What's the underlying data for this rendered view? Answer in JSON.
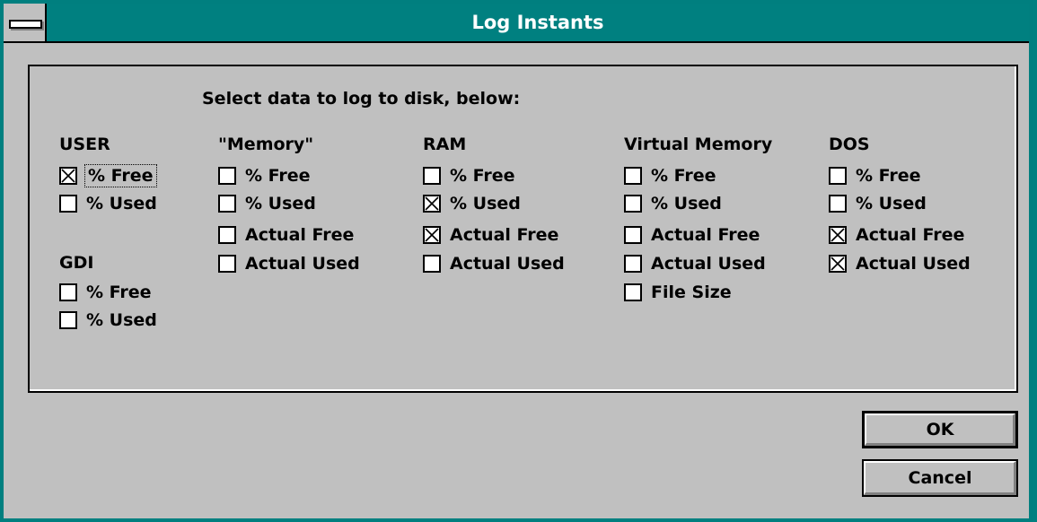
{
  "window": {
    "title": "Log Instants"
  },
  "instruction": "Select data to log to disk, below:",
  "groups": {
    "user": {
      "heading": "USER",
      "items": [
        {
          "label": "% Free",
          "checked": true
        },
        {
          "label": "% Used",
          "checked": false
        }
      ]
    },
    "gdi": {
      "heading": "GDI",
      "items": [
        {
          "label": "% Free",
          "checked": false
        },
        {
          "label": "% Used",
          "checked": false
        }
      ]
    },
    "memory": {
      "heading": "\"Memory\"",
      "items": [
        {
          "label": "% Free",
          "checked": false
        },
        {
          "label": "% Used",
          "checked": false
        },
        {
          "label": "Actual Free",
          "checked": false
        },
        {
          "label": "Actual Used",
          "checked": false
        }
      ]
    },
    "ram": {
      "heading": "RAM",
      "items": [
        {
          "label": "% Free",
          "checked": false
        },
        {
          "label": "% Used",
          "checked": true
        },
        {
          "label": "Actual Free",
          "checked": true
        },
        {
          "label": "Actual Used",
          "checked": false
        }
      ]
    },
    "virtual": {
      "heading": "Virtual Memory",
      "items": [
        {
          "label": "% Free",
          "checked": false
        },
        {
          "label": "% Used",
          "checked": false
        },
        {
          "label": "Actual Free",
          "checked": false
        },
        {
          "label": "Actual Used",
          "checked": false
        },
        {
          "label": "File Size",
          "checked": false
        }
      ]
    },
    "dos": {
      "heading": "DOS",
      "items": [
        {
          "label": "% Free",
          "checked": false
        },
        {
          "label": "% Used",
          "checked": false
        },
        {
          "label": "Actual Free",
          "checked": true
        },
        {
          "label": "Actual Used",
          "checked": true
        }
      ]
    }
  },
  "buttons": {
    "ok": "OK",
    "cancel": "Cancel"
  }
}
